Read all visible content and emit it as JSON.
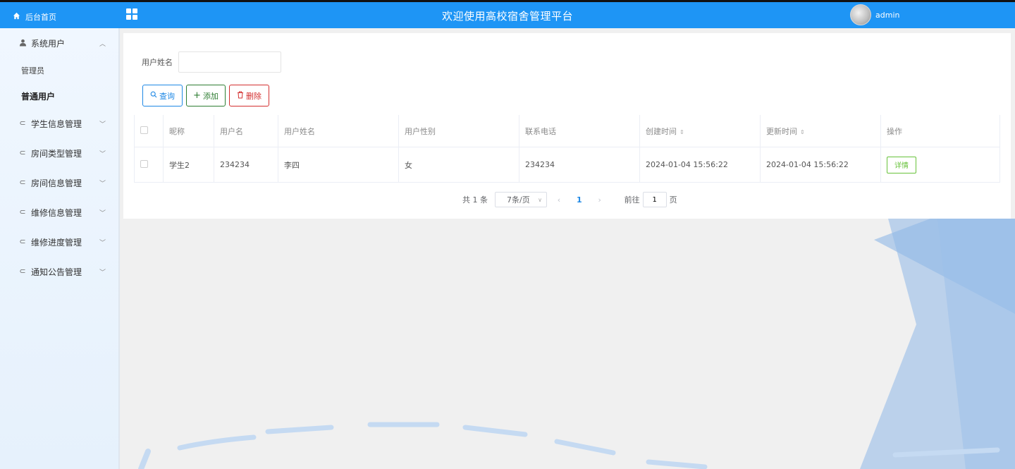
{
  "header": {
    "home_label": "后台首页",
    "title": "欢迎使用高校宿舍管理平台",
    "username": "admin",
    "bar_color": "#1e95f5"
  },
  "sidebar": {
    "items": [
      {
        "label": "系统用户",
        "icon": "user-icon",
        "expanded": true,
        "children": [
          {
            "label": "管理员"
          },
          {
            "label": "普通用户",
            "active": true
          }
        ]
      },
      {
        "label": "学生信息管理",
        "icon": "menu-icon"
      },
      {
        "label": "房间类型管理",
        "icon": "menu-icon"
      },
      {
        "label": "房间信息管理",
        "icon": "menu-icon"
      },
      {
        "label": "维修信息管理",
        "icon": "menu-icon"
      },
      {
        "label": "维修进度管理",
        "icon": "menu-icon"
      },
      {
        "label": "通知公告管理",
        "icon": "menu-icon"
      }
    ]
  },
  "search": {
    "label": "用户姓名",
    "value": "",
    "placeholder": ""
  },
  "buttons": {
    "query": "查询",
    "add": "添加",
    "delete": "删除"
  },
  "table": {
    "columns": [
      "昵称",
      "用户名",
      "用户姓名",
      "用户性别",
      "联系电话",
      "创建时间",
      "更新时间",
      "操作"
    ],
    "rows": [
      {
        "nickname": "学生2",
        "username": "234234",
        "real_name": "李四",
        "gender": "女",
        "phone": "234234",
        "created": "2024-01-04 15:56:22",
        "updated": "2024-01-04 15:56:22",
        "action": "详情"
      }
    ]
  },
  "pagination": {
    "total": "共 1 条",
    "page_size": "7条/页",
    "current": "1",
    "goto_label": "前往",
    "goto_value": "1",
    "page_unit": "页"
  }
}
